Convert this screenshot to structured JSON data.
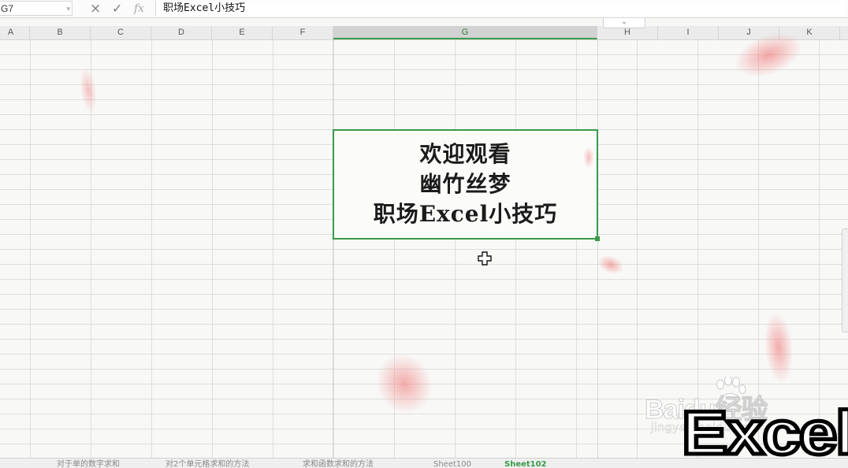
{
  "formula_bar": {
    "name_box": "G7",
    "cancel_icon": "×",
    "confirm_icon": "✓",
    "fx_label": "fx",
    "formula_value": "职场Excel小技巧",
    "expand_icon": "⌄"
  },
  "columns": [
    "A",
    "B",
    "C",
    "D",
    "E",
    "F",
    "G",
    "H",
    "I",
    "J",
    "K"
  ],
  "active_column": "G",
  "selected_cell": {
    "lines": [
      "欢迎观看",
      "幽竹丝梦",
      "职场Excel小技巧"
    ]
  },
  "sheet_tabs": [
    "对于单的数字求和",
    "对2个单元格求和的方法",
    "求和函数求和的方法",
    "Sheet100",
    "Sheet102"
  ],
  "watermark": {
    "brand": "Baidu经验",
    "url": "jingyan.baidu.com",
    "logo_text": "Excel"
  },
  "colors": {
    "selection_border": "#3a9a48",
    "petal": "#f0a0a0"
  },
  "icons": {
    "cursor": "cell-select-cross-icon",
    "paw": "baidu-paw-icon"
  }
}
